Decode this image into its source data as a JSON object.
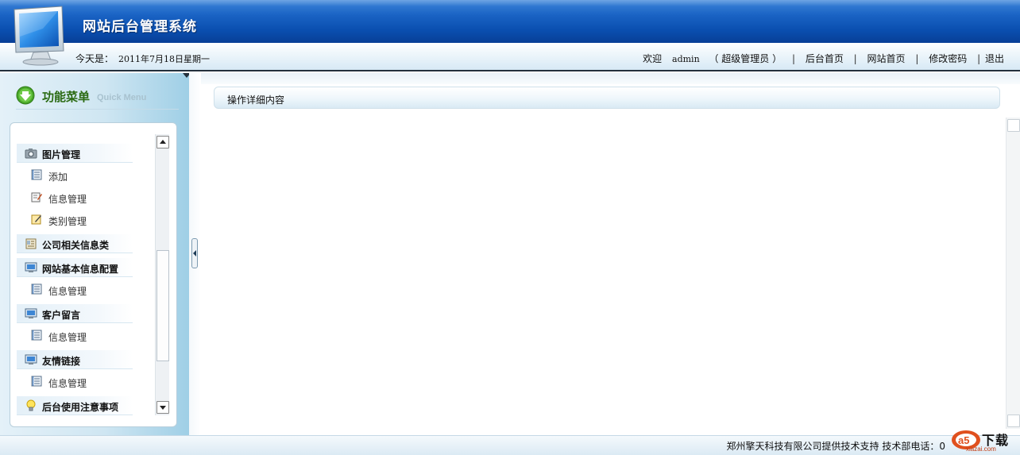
{
  "header": {
    "app_title": "网站后台管理系统",
    "today_label": "今天是：",
    "today_date": "2011年7月18日星期一",
    "welcome": "欢迎",
    "username": "admin",
    "role": "（ 超级管理员 ）",
    "separator": "|",
    "links": [
      "后台首页",
      "网站首页",
      "修改密码",
      "退出"
    ]
  },
  "sidebar": {
    "menu_title": "功能菜单",
    "menu_subtitle": "Quick Menu",
    "groups": [
      {
        "label": "图片管理",
        "icon": "camera-icon",
        "items": [
          "添加",
          "信息管理",
          "类别管理"
        ]
      },
      {
        "label": "公司相关信息类",
        "icon": "address-book-icon",
        "items": []
      },
      {
        "label": "网站基本信息配置",
        "icon": "monitor-icon",
        "items": [
          "信息管理"
        ]
      },
      {
        "label": "客户留言",
        "icon": "monitor-icon",
        "items": [
          "信息管理"
        ]
      },
      {
        "label": "友情链接",
        "icon": "monitor-icon",
        "items": [
          "信息管理"
        ]
      },
      {
        "label": "后台使用注意事项",
        "icon": "lightbulb-icon",
        "items": []
      }
    ]
  },
  "main": {
    "panel_title": "操作详细内容"
  },
  "footer": {
    "text": "郑州擎天科技有限公司提供技术支持 技术部电话：0"
  },
  "watermark": {
    "brand": "下载",
    "sub": "xiazai.com"
  },
  "colors": {
    "header_blue": "#0a4fb0",
    "menu_title_green": "#2a6a12"
  }
}
